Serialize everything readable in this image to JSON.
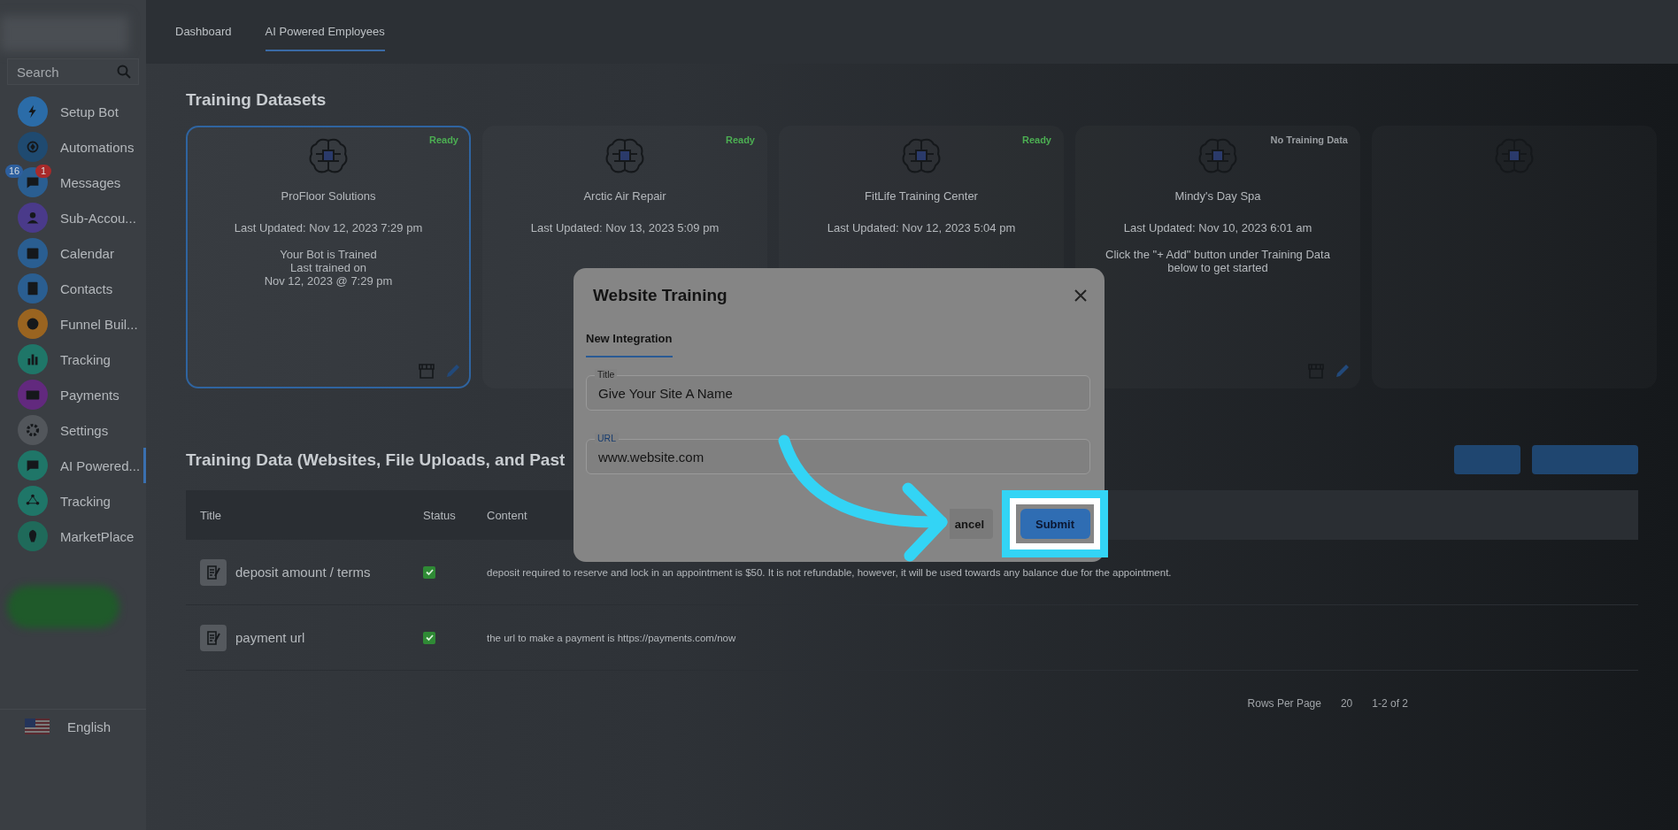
{
  "sidebar": {
    "search": {
      "placeholder": "Search"
    },
    "items": [
      {
        "label": "Setup Bot",
        "color": "#2b6ca8",
        "selected": false
      },
      {
        "label": "Automations",
        "color": "#1f4a70",
        "selected": false
      },
      {
        "label": "Messages",
        "color": "#2a5e91",
        "selected": false,
        "badges": [
          {
            "text": "16",
            "color": "#2d5f9e"
          },
          {
            "text": "1",
            "color": "#a82a2a"
          }
        ]
      },
      {
        "label": "Sub-Accou...",
        "color": "#4a3a8a",
        "selected": false
      },
      {
        "label": "Calendar",
        "color": "#2a5e91",
        "selected": false
      },
      {
        "label": "Contacts",
        "color": "#2a5e91",
        "selected": false
      },
      {
        "label": "Funnel Buil...",
        "color": "#9a6420",
        "selected": false
      },
      {
        "label": "Tracking",
        "color": "#1f7668",
        "selected": false
      },
      {
        "label": "Payments",
        "color": "#62297e",
        "selected": false
      },
      {
        "label": "Settings",
        "color": "#52565b",
        "selected": false
      },
      {
        "label": "AI Powered...",
        "color": "#1f7668",
        "selected": true
      },
      {
        "label": "Tracking",
        "color": "#1f7668",
        "selected": false
      },
      {
        "label": "MarketPlace",
        "color": "#1f6a5a",
        "selected": false
      }
    ],
    "language": "English"
  },
  "tabs": [
    {
      "label": "Dashboard",
      "selected": false
    },
    {
      "label": "AI Powered Employees",
      "selected": true
    }
  ],
  "datasets": {
    "title": "Training Datasets",
    "cards": [
      {
        "name": "ProFloor Solutions",
        "status": "Ready",
        "trained": true,
        "updated": "Last Updated: Nov 12, 2023 7:29 pm",
        "note": "Your Bot is Trained\nLast trained on\nNov 12, 2023 @ 7:29 pm",
        "actions": true,
        "selected": true
      },
      {
        "name": "Arctic Air Repair",
        "status": "Ready",
        "trained": true,
        "updated": "Last Updated: Nov 13, 2023 5:09 pm",
        "selected": false
      },
      {
        "name": "FitLife Training Center",
        "status": "Ready",
        "trained": true,
        "updated": "Last Updated: Nov 12, 2023 5:04 pm",
        "selected": false
      },
      {
        "name": "Mindy's Day Spa",
        "status": "No Training Data",
        "trained": false,
        "updated": "Last Updated: Nov 10, 2023 6:01 am",
        "note": "Click the \"+ Add\" button under Training Data below to get started",
        "actions": true,
        "selected": false
      },
      {
        "selected": false
      }
    ]
  },
  "training_data": {
    "title": "Training Data (Websites, File Uploads, and Past",
    "columns": [
      "Title",
      "Status",
      "Content"
    ],
    "rows": [
      {
        "title": "deposit amount / terms",
        "checked": true,
        "content": "deposit required to reserve and lock in an appointment is $50. It is not refundable, however, it will be used towards any balance due for the appointment."
      },
      {
        "title": "payment url",
        "checked": true,
        "content": "the url to make a payment is https://payments.com/now"
      }
    ],
    "pagination": {
      "label": "Rows Per Page",
      "rows_per_page": "20",
      "range": "1-2 of 2"
    }
  },
  "modal": {
    "title": "Website Training",
    "tabs": [
      {
        "label": "New Integration",
        "selected": true
      }
    ],
    "fields": [
      {
        "label": "Title",
        "value": "Give Your Site A Name",
        "focused": false
      },
      {
        "label": "URL",
        "value": "www.website.com",
        "focused": true
      }
    ],
    "buttons": [
      {
        "label": "ancel",
        "kind": "text"
      },
      {
        "label": "Submit",
        "kind": "primary"
      }
    ]
  }
}
